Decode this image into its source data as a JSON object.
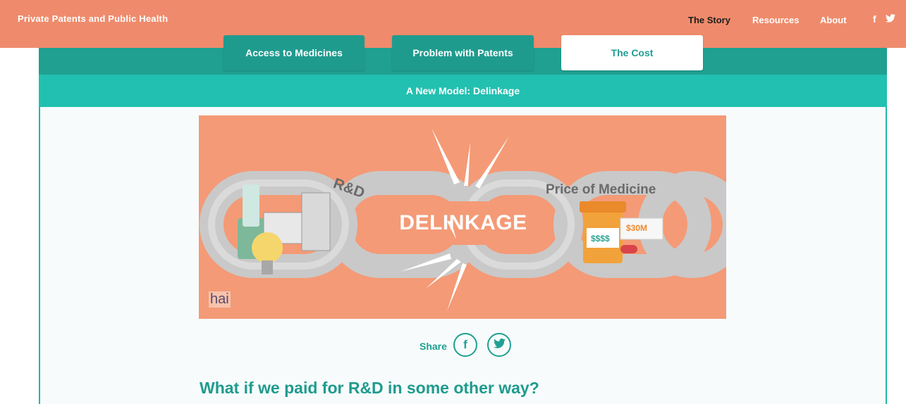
{
  "header": {
    "site_title": "Private Patents and Public Health",
    "nav": [
      {
        "label": "The Story",
        "active": true
      },
      {
        "label": "Resources",
        "active": false
      },
      {
        "label": "About",
        "active": false
      }
    ],
    "social": [
      {
        "icon": "facebook-icon",
        "glyph": "f"
      },
      {
        "icon": "twitter-icon",
        "glyph": "🐦"
      }
    ]
  },
  "tabs": [
    {
      "label": "Access to Medicines",
      "active": false
    },
    {
      "label": "Problem with Patents",
      "active": false
    },
    {
      "label": "The Cost",
      "active": true
    }
  ],
  "subtab": {
    "label": "A New Model: Delinkage"
  },
  "hero": {
    "center_text": "DELINKAGE",
    "left_label": "R&D",
    "right_label": "Price of Medicine",
    "price_tag": "$30M",
    "bottle_text": "$$$$",
    "logo_text": "hai"
  },
  "share": {
    "label": "Share",
    "buttons": [
      {
        "icon": "facebook-icon",
        "glyph": "f"
      },
      {
        "icon": "twitter-icon",
        "glyph": "🐦"
      }
    ]
  },
  "article": {
    "heading": "What if we paid for R&D in some other way?"
  },
  "colors": {
    "header": "#ef8b6c",
    "teal_dark": "#1fa091",
    "teal_light": "#22c0b0",
    "hero_bg": "#f49a76"
  }
}
